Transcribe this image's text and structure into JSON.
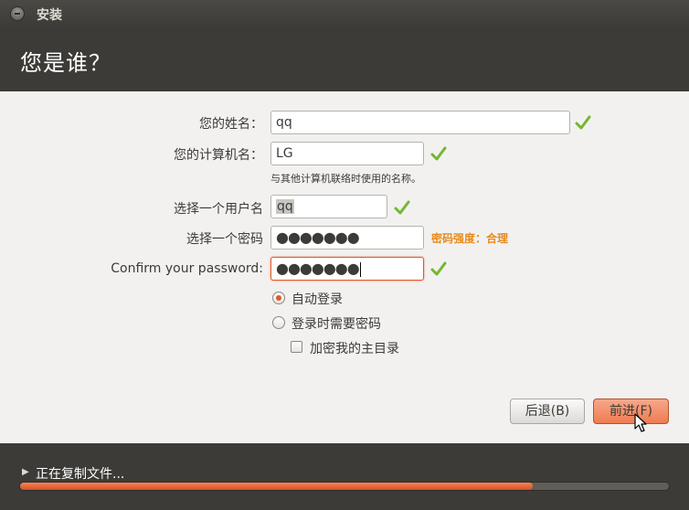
{
  "window": {
    "title": "安装"
  },
  "header": {
    "title": "您是谁？"
  },
  "form": {
    "name": {
      "label": "您的姓名：",
      "value": "qq"
    },
    "computer_name": {
      "label": "您的计算机名：",
      "value": "LG",
      "hint": "与其他计算机联络时使用的名称。"
    },
    "username": {
      "label": "选择一个用户名",
      "value": "qq"
    },
    "password": {
      "label": "选择一个密码",
      "value": "●●●●●●●",
      "strength": "密码强度：合理"
    },
    "confirm_password": {
      "label": "Confirm your password:",
      "value": "●●●●●●●"
    },
    "login_options": [
      {
        "label": "自动登录",
        "selected": true
      },
      {
        "label": "登录时需要密码",
        "selected": false
      }
    ],
    "encrypt_home": {
      "label": "加密我的主目录",
      "checked": false
    }
  },
  "buttons": {
    "back": "后退(B)",
    "next": "前进(F)"
  },
  "footer": {
    "status": "正在复制文件...",
    "progress": 0.79
  },
  "colors": {
    "accent": "#e2582a",
    "check": "#75b72f",
    "strength": "#e88a1a"
  },
  "icons": {
    "field_valid": "checkmark-icon",
    "expander": "triangle-right-icon"
  }
}
